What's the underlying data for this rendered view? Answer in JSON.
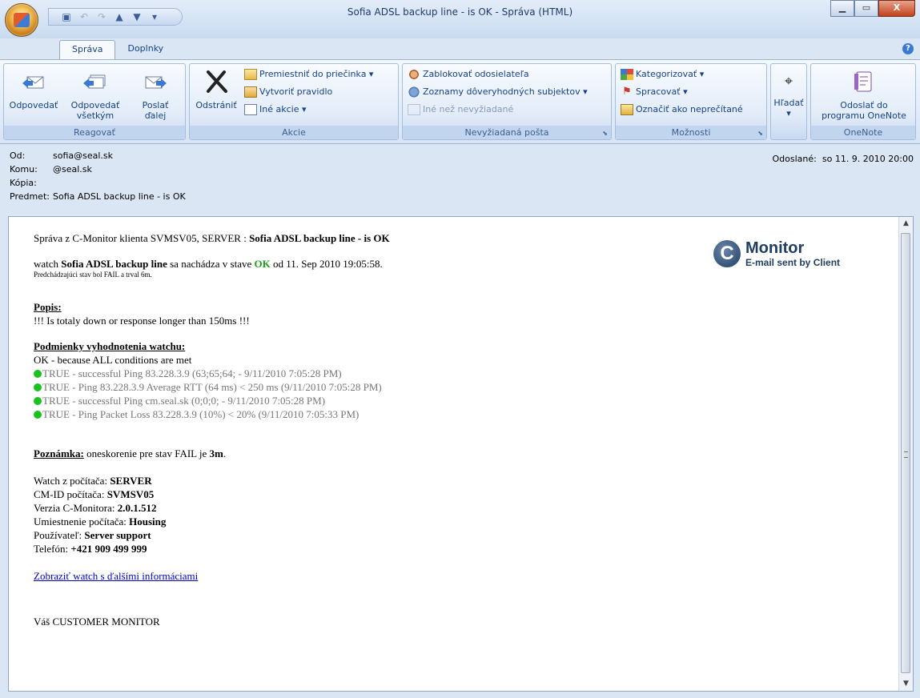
{
  "window": {
    "title": "Sofia ADSL backup line - is OK - Správa (HTML)",
    "tabs": [
      "Správa",
      "Doplnky"
    ]
  },
  "ribbon": {
    "reagovat": {
      "label": "Reagovať",
      "reply": [
        "Odpovedať",
        ""
      ],
      "reply_all": [
        "Odpovedať",
        "všetkým"
      ],
      "forward": [
        "Poslať",
        "ďalej"
      ]
    },
    "akcie": {
      "label": "Akcie",
      "delete": "Odstrániť",
      "move": "Premiestniť do priečinka ▾",
      "rule": "Vytvoriť pravidlo",
      "other": "Iné akcie ▾"
    },
    "nevyziadana": {
      "label": "Nevyžiadaná pošta",
      "block": "Zablokovať odosielateľa",
      "trusted": "Zoznamy dôveryhodných subjektov ▾",
      "notjunk": "Iné než nevyžiadané"
    },
    "moznosti": {
      "label": "Možnosti",
      "categorize": "Kategorizovať ▾",
      "process": "Spracovať ▾",
      "unread": "Označiť ako neprečítané"
    },
    "find": {
      "label": "Hľadať"
    },
    "onenote": {
      "label": "OneNote",
      "send": [
        "Odoslať do",
        "programu OneNote"
      ]
    }
  },
  "header": {
    "from_label": "Od:",
    "from": "sofia@seal.sk",
    "to_label": "Komu:",
    "to": "@seal.sk",
    "cc_label": "Kópia:",
    "cc": "",
    "subject_label": "Predmet:",
    "subject": "Sofia ADSL backup line - is OK",
    "sent_label": "Odoslané:",
    "sent": "so 11. 9. 2010 20:00"
  },
  "message": {
    "line1_pre": "Správa z C-Monitor klienta SVMSV05, SERVER : ",
    "line1_bold": "Sofia ADSL backup line - is OK",
    "line2_a": "watch ",
    "line2_bold": "Sofia ADSL backup line",
    "line2_b": " sa nachádza v stave ",
    "line2_ok": "OK",
    "line2_c": " od 11. Sep 2010 19:05:58.",
    "line3": "Predchádzajúci stav bol FAIL a trval 6m.",
    "popis_title": "Popis:",
    "popis_text": "!!! Is totaly down or response longer than 150ms !!!",
    "cond_title": "Podmienky vyhodnotenia watchu:",
    "cond_summary": "OK - because ALL conditions are met",
    "conditions": [
      "TRUE - successful Ping 83.228.3.9   (63;65;64; - 9/11/2010 7:05:28 PM)",
      "TRUE - Ping 83.228.3.9   Average RTT (64 ms) < 250 ms (9/11/2010 7:05:28 PM)",
      "TRUE - successful Ping cm.seal.sk (0;0;0; - 9/11/2010 7:05:28 PM)",
      "TRUE - Ping Packet Loss 83.228.3.9   (10%) < 20% (9/11/2010 7:05:33 PM)"
    ],
    "note_title": "Poznámka:",
    "note_text": " oneskorenie pre stav FAIL je ",
    "note_bold": "3m",
    "note_end": ".",
    "info": [
      {
        "label": "Watch z počítača: ",
        "value": "SERVER"
      },
      {
        "label": "CM-ID počítača: ",
        "value": "SVMSV05"
      },
      {
        "label": "Verzia C-Monitora: ",
        "value": "2.0.1.512"
      },
      {
        "label": "Umiestnenie počítača: ",
        "value": "Housing"
      },
      {
        "label": "Používateľ: ",
        "value": "Server support"
      },
      {
        "label": "Telefón: ",
        "value": "+421 909 499 999"
      }
    ],
    "link": "Zobraziť watch s ďalšími informáciami",
    "signature": "Váš CUSTOMER MONITOR"
  },
  "logo": {
    "letter": "C",
    "name": "Monitor",
    "tagline": "E-mail sent by Client"
  }
}
